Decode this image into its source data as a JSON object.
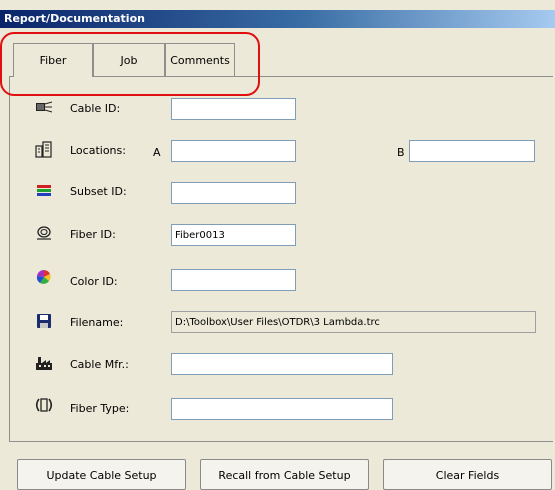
{
  "window": {
    "title": "Report/Documentation"
  },
  "tabs": [
    {
      "label": "Fiber",
      "active": true
    },
    {
      "label": "Job",
      "active": false
    },
    {
      "label": "Comments",
      "active": false
    }
  ],
  "fields": {
    "cable_id": {
      "label": "Cable ID:",
      "value": ""
    },
    "locations": {
      "label": "Locations:",
      "a_label": "A",
      "a_value": "",
      "b_label": "B",
      "b_value": ""
    },
    "subset_id": {
      "label": "Subset ID:",
      "value": ""
    },
    "fiber_id": {
      "label": "Fiber ID:",
      "value": "Fiber0013"
    },
    "color_id": {
      "label": "Color ID:",
      "value": ""
    },
    "filename": {
      "label": "Filename:",
      "value": "D:\\Toolbox\\User Files\\OTDR\\3 Lambda.trc"
    },
    "cable_mfr": {
      "label": "Cable Mfr.:",
      "value": ""
    },
    "fiber_type": {
      "label": "Fiber Type:",
      "value": ""
    }
  },
  "buttons": {
    "update": "Update Cable Setup",
    "recall": "Recall from Cable Setup",
    "clear": "Clear Fields"
  },
  "colors": {
    "highlight": "#e01010",
    "titlebar": "#0a246a"
  },
  "icons": [
    "cable-icon",
    "building-icon",
    "subset-icon",
    "fiber-icon",
    "color-wheel-icon",
    "floppy-disk-icon",
    "factory-icon",
    "fiber-type-icon"
  ]
}
